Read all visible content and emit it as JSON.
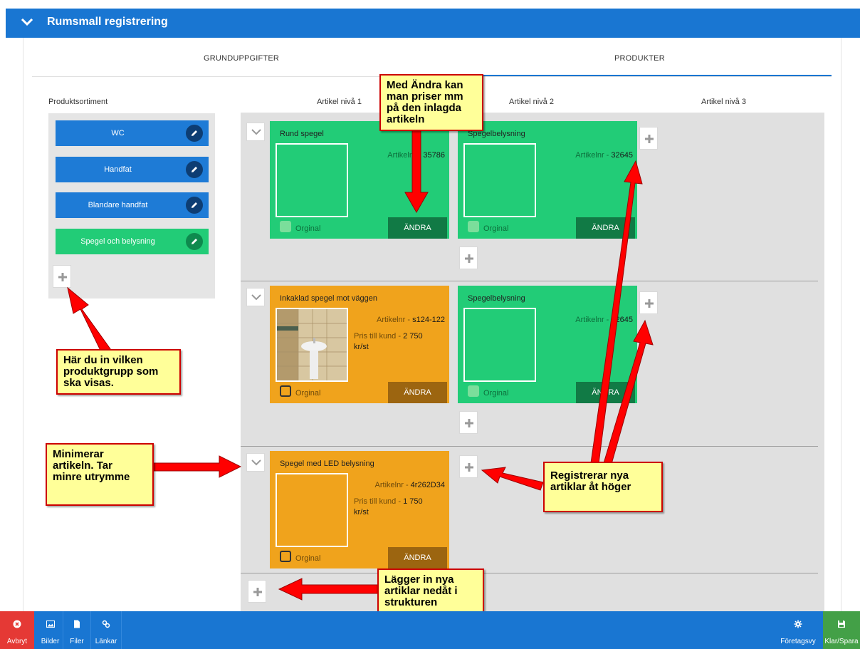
{
  "header": {
    "title": "Rumsmall registrering"
  },
  "tabs": {
    "basic": "GRUNDUPPGIFTER",
    "products": "PRODUKTER"
  },
  "columns": {
    "sortiment": "Produktsortiment",
    "level1": "Artikel nivå 1",
    "level2": "Artikel nivå 2",
    "level3": "Artikel nivå 3"
  },
  "categories": [
    {
      "label": "WC",
      "selected": false
    },
    {
      "label": "Handfat",
      "selected": false
    },
    {
      "label": "Blandare handfat",
      "selected": false
    },
    {
      "label": "Spegel och belysning",
      "selected": true
    }
  ],
  "cards": {
    "r1c1": {
      "title": "Rund spegel",
      "artnr_label": "Artikelnr - ",
      "artnr": "35786",
      "original": "Orginal",
      "edit": "ÄNDRA"
    },
    "r1c2": {
      "title": "Spegelbelysning",
      "artnr_label": "Artikelnr - ",
      "artnr": "32645",
      "original": "Orginal",
      "edit": "ÄNDRA"
    },
    "r2c1": {
      "title": "Inkaklad spegel mot väggen",
      "artnr_label": "Artikelnr - ",
      "artnr": "s124-122",
      "price_label": "Pris till kund - ",
      "price": "2 750",
      "unit": "kr/st",
      "original": "Orginal",
      "edit": "ÄNDRA"
    },
    "r2c2": {
      "title": "Spegelbelysning",
      "artnr_label": "Artikelnr - ",
      "artnr": "32645",
      "original": "Orginal",
      "edit": "ÄNDRA"
    },
    "r3c1": {
      "title": "Spegel med LED belysning",
      "artnr_label": "Artikelnr - ",
      "artnr": "4r262D34",
      "price_label": "Pris till kund - ",
      "price": "1 750",
      "unit": "kr/st",
      "original": "Orginal",
      "edit": "ÄNDRA"
    }
  },
  "callouts": {
    "edit": [
      "Med Ändra kan",
      "man priser mm",
      "på den inlagda",
      "artikeln"
    ],
    "group": [
      "Här du in vilken",
      "produktgrupp som",
      "ska visas."
    ],
    "minimize": [
      "Minimerar",
      "artikeln. Tar",
      "minre utrymme"
    ],
    "register": [
      "Registrerar nya",
      "artiklar åt höger"
    ],
    "add_down": [
      "Lägger in nya",
      "artiklar nedåt i",
      "strukturen"
    ]
  },
  "footer": {
    "cancel": "Avbryt",
    "images": "Bilder",
    "files": "Filer",
    "links": "Länkar",
    "company_view": "Företagsvy",
    "done_save": "Klar/Spara"
  },
  "colors": {
    "primary": "#1976d2",
    "green": "#22cc77",
    "orange": "#f0a31c",
    "danger": "#e53935",
    "success": "#43a047",
    "callout_bg": "#ffff99",
    "arrow": "#ff0000"
  },
  "icons": [
    "chevron-down-icon",
    "pencil-icon",
    "plus-icon",
    "close-circle-icon",
    "image-icon",
    "file-icon",
    "link-icon",
    "gear-icon",
    "save-icon"
  ]
}
